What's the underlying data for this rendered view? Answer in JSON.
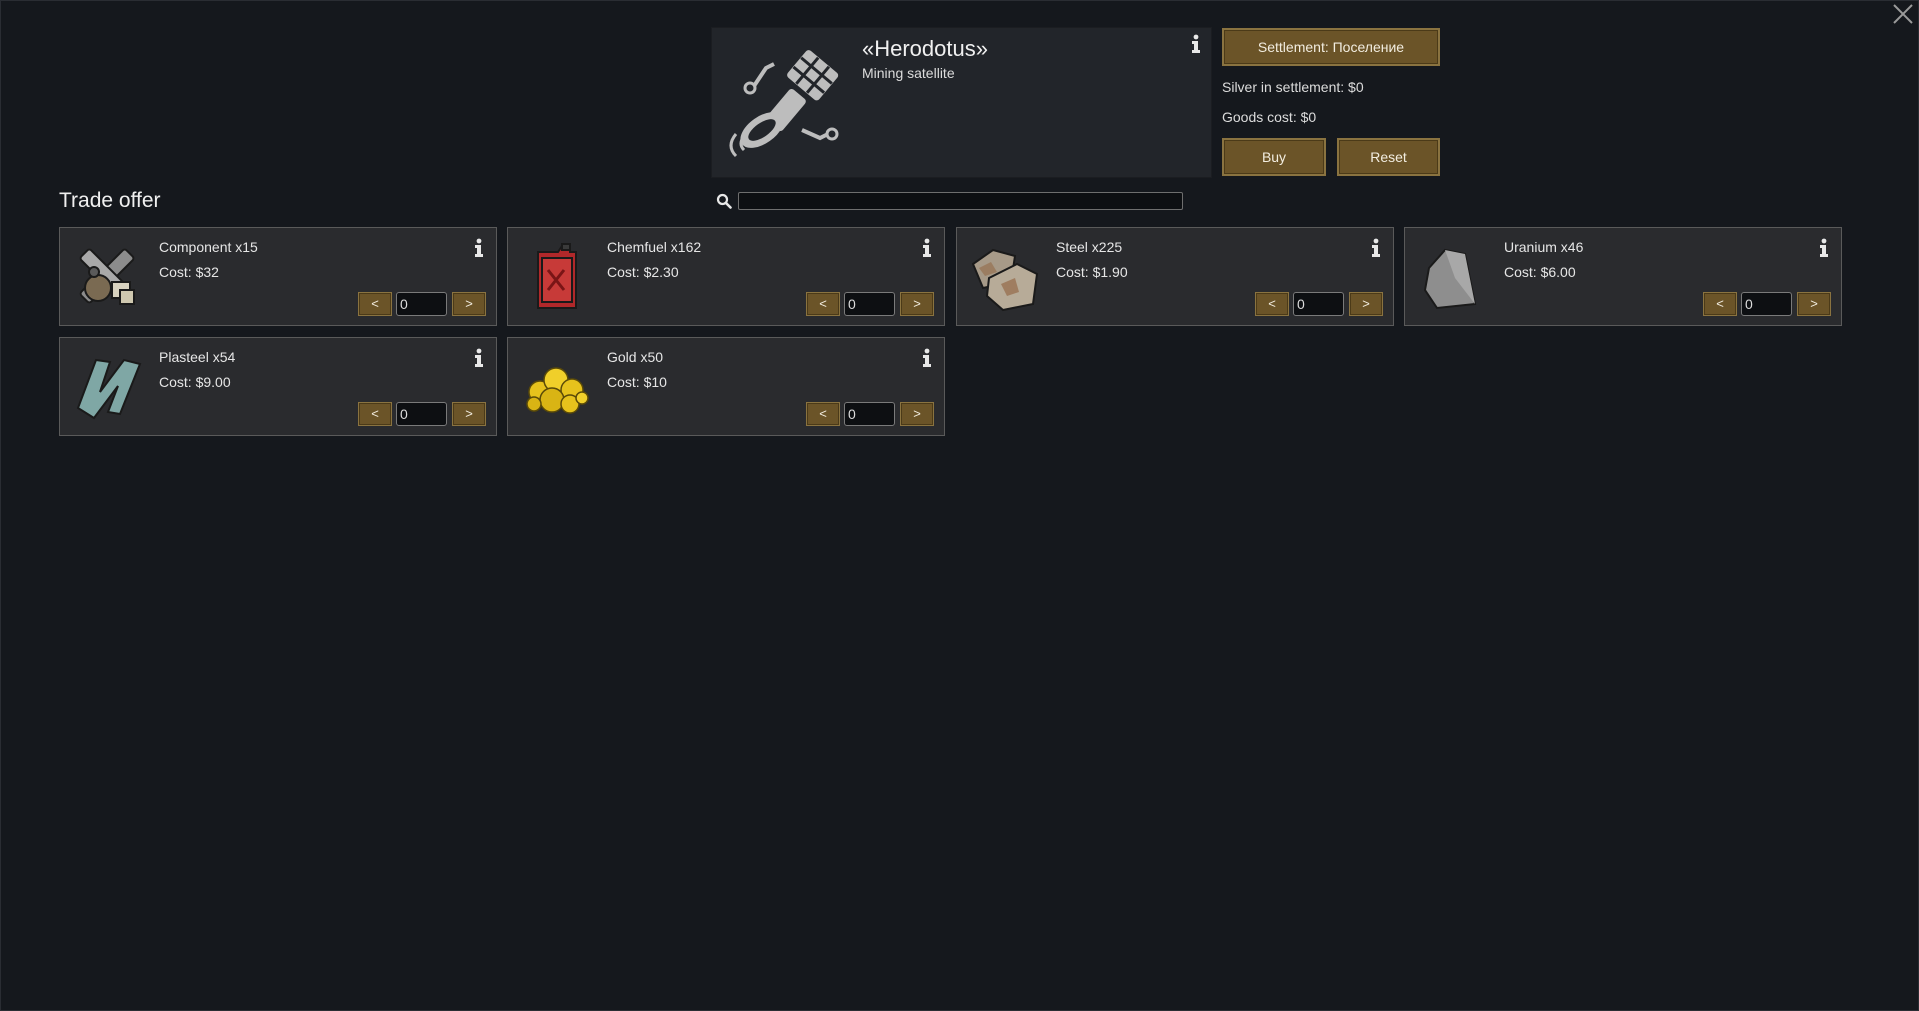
{
  "header": {
    "title": "«Herodotus»",
    "subtitle": "Mining satellite",
    "icon": "mining-satellite-icon"
  },
  "side_panel": {
    "settlement_label": "Settlement: Поселение",
    "silver_text": "Silver in settlement: $0",
    "goods_cost_text": "Goods cost: $0",
    "buy_label": "Buy",
    "reset_label": "Reset"
  },
  "trade_offer": {
    "title": "Trade offer",
    "search_value": ""
  },
  "items": [
    {
      "name": "Component x15",
      "cost": "Cost: $32",
      "qty": "0",
      "dec": "<",
      "inc": ">",
      "icon": "component-icon"
    },
    {
      "name": "Chemfuel x162",
      "cost": "Cost: $2.30",
      "qty": "0",
      "dec": "<",
      "inc": ">",
      "icon": "chemfuel-icon"
    },
    {
      "name": "Steel x225",
      "cost": "Cost: $1.90",
      "qty": "0",
      "dec": "<",
      "inc": ">",
      "icon": "steel-icon"
    },
    {
      "name": "Uranium x46",
      "cost": "Cost: $6.00",
      "qty": "0",
      "dec": "<",
      "inc": ">",
      "icon": "uranium-icon"
    },
    {
      "name": "Plasteel x54",
      "cost": "Cost: $9.00",
      "qty": "0",
      "dec": "<",
      "inc": ">",
      "icon": "plasteel-icon"
    },
    {
      "name": "Gold x50",
      "cost": "Cost: $10",
      "qty": "0",
      "dec": "<",
      "inc": ">",
      "icon": "gold-icon"
    }
  ],
  "colors": {
    "background": "#15181d",
    "button_gold": "#6b5428",
    "card": "#2a2b2e"
  }
}
